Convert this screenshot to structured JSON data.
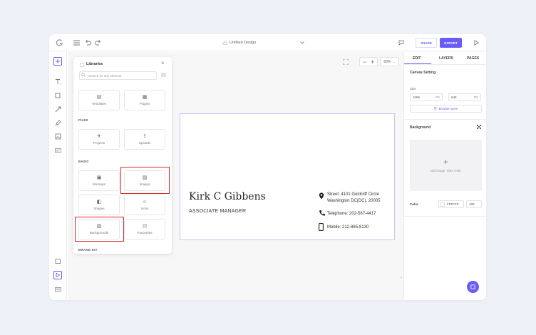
{
  "topbar": {
    "design_title": "Untitled Design",
    "share_label": "SHARE",
    "export_label": "EXPORT"
  },
  "libraries": {
    "title": "Libraries",
    "search_placeholder": "Search for any element",
    "sections": {
      "files": "FILES",
      "basic": "BASIC",
      "brand_kit": "BRAND KIT"
    },
    "tiles": {
      "templates": "Templates",
      "plugins": "Plugins",
      "projects": "Projects",
      "uploads": "Uploads",
      "mockups": "Mockups",
      "images": "Images",
      "shapes": "Shapes",
      "icons": "Icons",
      "backgrounds": "Backgrounds",
      "favourites": "Favourites"
    }
  },
  "canvas": {
    "zoom": "60%",
    "name": "Kirk C Gibbens",
    "role": "ASSOCIATE MANAGER",
    "street_line1": "Street: 4101 Goldcliff Circle",
    "street_line2": "Washington DC(DC), 20005",
    "telephone": "Telephone: 202-587-4417",
    "mobile": "Mobile: 212-885-8130"
  },
  "right_panel": {
    "tabs": [
      "EDIT",
      "LAYERS",
      "PAGES"
    ],
    "canvas_setting": "Canvas Setting",
    "size_label": "Size",
    "width": "1096",
    "height": "648",
    "unit": "PX",
    "browse_sizes": "Browse sizes",
    "background_label": "Background",
    "add_image": "Add image. Max 4 Mb.",
    "color_label": "Color",
    "color_hex": "FFFFFF",
    "opacity": "100"
  },
  "colors": {
    "accent": "#6a5cf6",
    "highlight": "#d9262b"
  }
}
